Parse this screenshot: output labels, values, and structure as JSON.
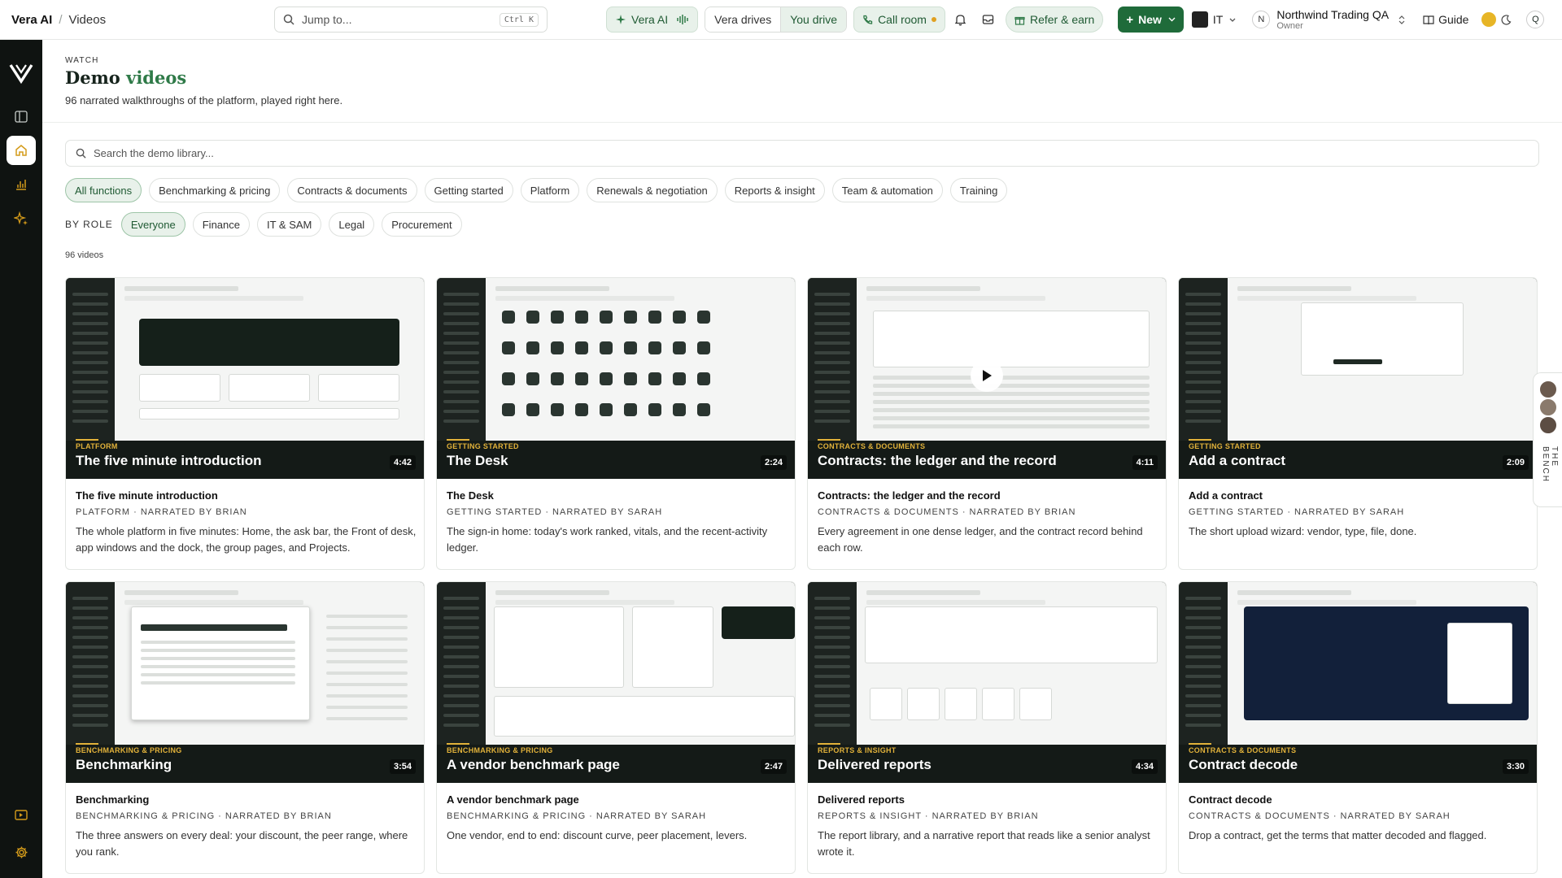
{
  "topbar": {
    "app_name": "Vera AI",
    "breadcrumb": "Videos",
    "jump_placeholder": "Jump to...",
    "jump_shortcut": "Ctrl K",
    "vera_ai_label": "Vera AI",
    "mode_options": [
      "Vera drives",
      "You drive"
    ],
    "mode_selected": "You drive",
    "call_room_label": "Call room",
    "refer_label": "Refer & earn",
    "new_label": "New",
    "org_label": "IT",
    "account_initial": "N",
    "account_name": "Northwind Trading QA",
    "account_role": "Owner",
    "guide_label": "Guide",
    "user_initial": "Q"
  },
  "header": {
    "eyebrow": "WATCH",
    "title_plain": "Demo ",
    "title_accent": "videos",
    "subtitle": "96 narrated walkthroughs of the platform, played right here."
  },
  "search": {
    "placeholder": "Search the demo library..."
  },
  "function_filters": [
    "All functions",
    "Benchmarking & pricing",
    "Contracts & documents",
    "Getting started",
    "Platform",
    "Renewals & negotiation",
    "Reports & insight",
    "Team & automation",
    "Training"
  ],
  "function_selected": "All functions",
  "role_label": "BY ROLE",
  "role_filters": [
    "Everyone",
    "Finance",
    "IT & SAM",
    "Legal",
    "Procurement"
  ],
  "role_selected": "Everyone",
  "video_count": "96 videos",
  "videos": [
    {
      "category": "Platform",
      "title": "The five minute introduction",
      "duration": "4:42",
      "meta": "PLATFORM · NARRATED BY BRIAN",
      "desc": "The whole platform in five minutes: Home, the ask bar, the Front of desk, app windows and the dock, the group pages, and Projects."
    },
    {
      "category": "Getting started",
      "title": "The Desk",
      "duration": "2:24",
      "meta": "GETTING STARTED · NARRATED BY SARAH",
      "desc": "The sign-in home: today's work ranked, vitals, and the recent-activity ledger."
    },
    {
      "category": "Contracts & documents",
      "title": "Contracts: the ledger and the record",
      "duration": "4:11",
      "meta": "CONTRACTS & DOCUMENTS · NARRATED BY BRIAN",
      "desc": "Every agreement in one dense ledger, and the contract record behind each row."
    },
    {
      "category": "Getting started",
      "title": "Add a contract",
      "duration": "2:09",
      "meta": "GETTING STARTED · NARRATED BY SARAH",
      "desc": "The short upload wizard: vendor, type, file, done."
    },
    {
      "category": "Benchmarking & pricing",
      "title": "Benchmarking",
      "duration": "3:54",
      "meta": "BENCHMARKING & PRICING · NARRATED BY BRIAN",
      "desc": "The three answers on every deal: your discount, the peer range, where you rank."
    },
    {
      "category": "Benchmarking & pricing",
      "title": "A vendor benchmark page",
      "duration": "2:47",
      "meta": "BENCHMARKING & PRICING · NARRATED BY SARAH",
      "desc": "One vendor, end to end: discount curve, peer placement, levers."
    },
    {
      "category": "Reports & insight",
      "title": "Delivered reports",
      "duration": "4:34",
      "meta": "REPORTS & INSIGHT · NARRATED BY BRIAN",
      "desc": "The report library, and a narrative report that reads like a senior analyst wrote it."
    },
    {
      "category": "Contracts & documents",
      "title": "Contract decode",
      "duration": "3:30",
      "meta": "CONTRACTS & DOCUMENTS · NARRATED BY SARAH",
      "desc": "Drop a contract, get the terms that matter decoded and flagged."
    }
  ],
  "bench_label": "THE BENCH",
  "colors": {
    "accent": "#1f6b3a",
    "accent_soft": "#e8f1ea",
    "category_gold": "#e2b23a",
    "sidebar": "#0f1311"
  }
}
